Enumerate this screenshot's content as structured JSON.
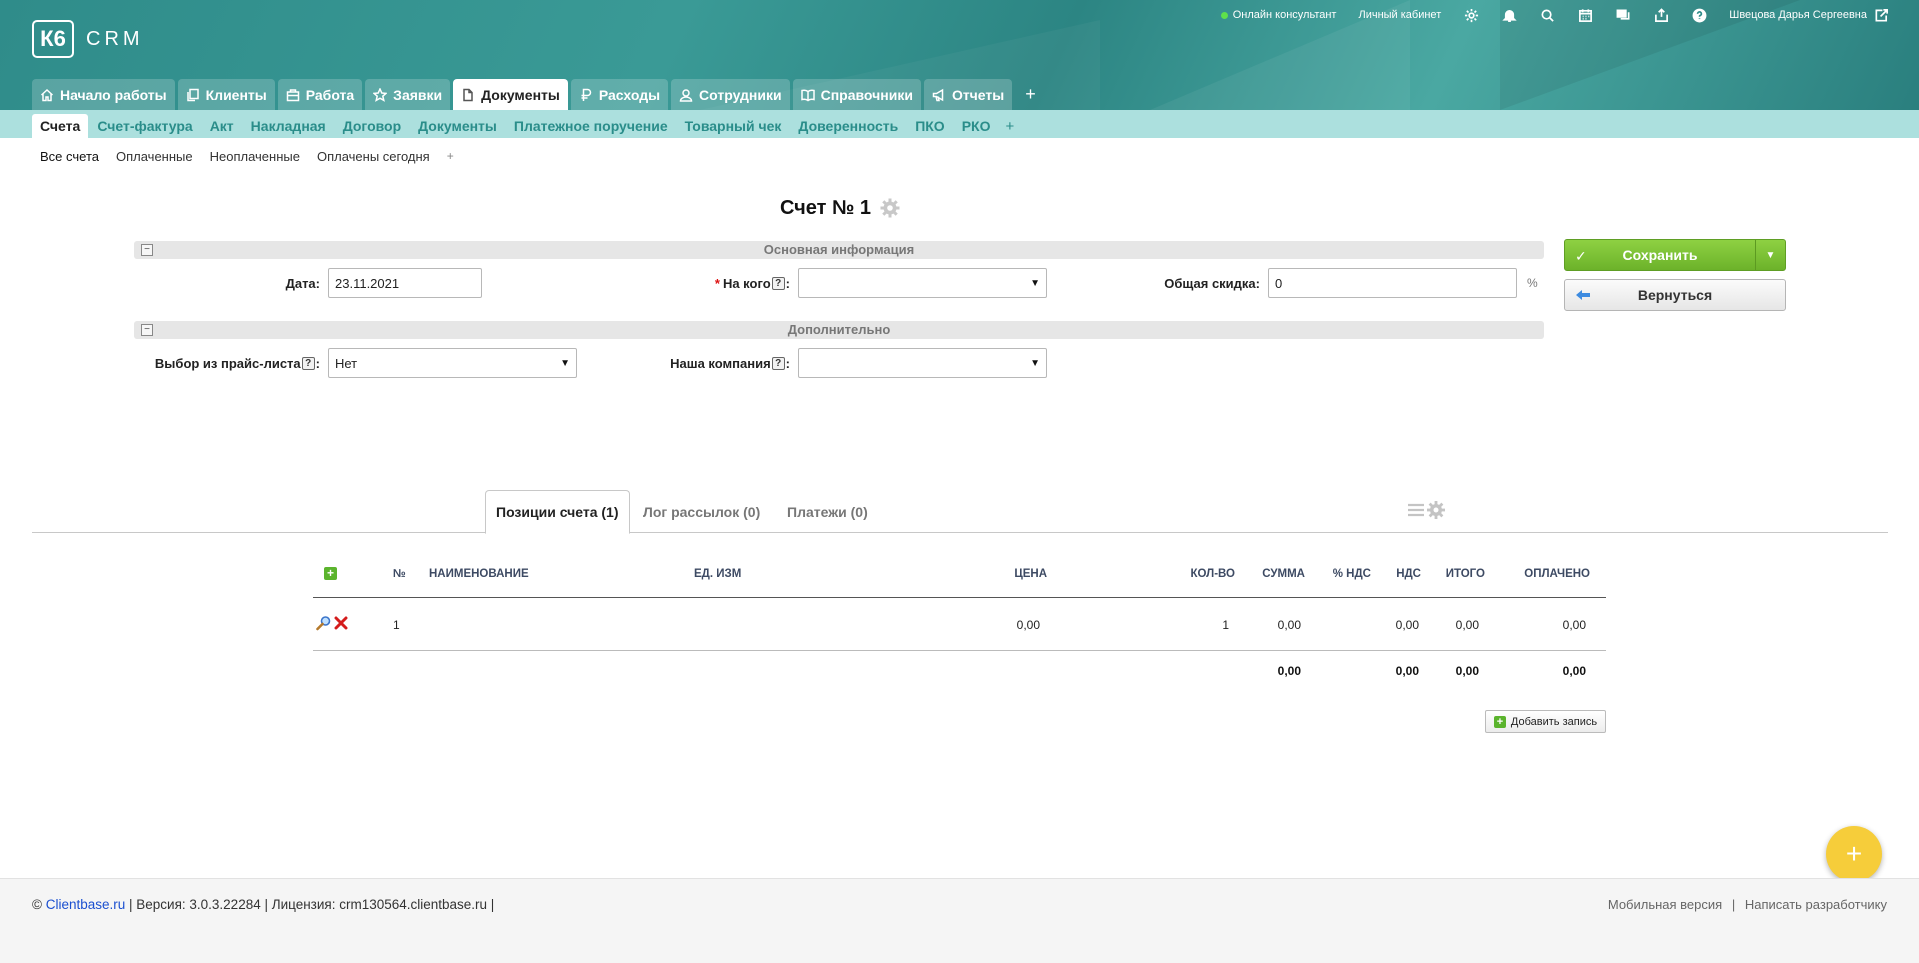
{
  "logo": {
    "mark": "К6",
    "text": "CRM"
  },
  "top_bar": {
    "online_consultant": "Онлайн консультант",
    "personal_cabinet": "Личный кабинет",
    "user_name": "Швецова Дарья Сергеевна",
    "status_color": "#5fe04a"
  },
  "main_tabs": [
    {
      "label": "Начало работы",
      "icon": "home-icon"
    },
    {
      "label": "Клиенты",
      "icon": "clients-icon"
    },
    {
      "label": "Работа",
      "icon": "work-icon"
    },
    {
      "label": "Заявки",
      "icon": "star-icon"
    },
    {
      "label": "Документы",
      "icon": "document-icon",
      "active": true
    },
    {
      "label": "Расходы",
      "icon": "ruble-icon"
    },
    {
      "label": "Сотрудники",
      "icon": "employees-icon"
    },
    {
      "label": "Справочники",
      "icon": "book-icon"
    },
    {
      "label": "Отчеты",
      "icon": "megaphone-icon"
    }
  ],
  "main_tabs_add": "+",
  "sub_tabs": [
    "Счета",
    "Счет-фактура",
    "Акт",
    "Накладная",
    "Договор",
    "Документы",
    "Платежное поручение",
    "Товарный чек",
    "Доверенность",
    "ПКО",
    "РКО"
  ],
  "sub_tabs_add": "+",
  "filters": [
    "Все счета",
    "Оплаченные",
    "Неоплаченные",
    "Оплачены сегодня"
  ],
  "filters_add": "+",
  "page_title": "Счет № 1",
  "sections": {
    "main": {
      "title": "Основная информация",
      "toggle": "−"
    },
    "extra": {
      "title": "Дополнительно",
      "toggle": "−"
    }
  },
  "form": {
    "date_label": "Дата:",
    "date_value": "23.11.2021",
    "recipient_req": "*",
    "recipient_label": "На кого",
    "recipient_value": "",
    "discount_label": "Общая скидка:",
    "discount_value": "0",
    "discount_unit": "%",
    "price_list_label": "Выбор из прайс-листа",
    "price_list_value": "Нет",
    "company_label": "Наша компания",
    "company_value": "",
    "help": "?",
    "colon": ":",
    "arrow": "▼"
  },
  "buttons": {
    "save": "Сохранить",
    "save_check": "✓",
    "save_dropdown": "▼",
    "back": "Вернуться",
    "add_record": "Добавить запись",
    "add_plus": "+",
    "fab": "+"
  },
  "lower_tabs": [
    "Позиции счета (1)",
    "Лог рассылок (0)",
    "Платежи (0)"
  ],
  "table": {
    "headers": {
      "num": "№",
      "name": "НАИМЕНОВАНИЕ",
      "unit": "ЕД. ИЗМ",
      "price": "ЦЕНА",
      "qty": "КОЛ-ВО",
      "sum": "СУММА",
      "vat_pct": "% НДС",
      "vat": "НДС",
      "total": "ИТОГО",
      "paid": "ОПЛАЧЕНО"
    },
    "rows": [
      {
        "num": "1",
        "name": "",
        "unit": "",
        "price": "0,00",
        "qty": "1",
        "sum": "0,00",
        "vat_pct": "",
        "vat": "0,00",
        "total": "0,00",
        "paid": "0,00"
      }
    ],
    "totals": {
      "sum": "0,00",
      "vat": "0,00",
      "total": "0,00",
      "paid": "0,00"
    }
  },
  "footer": {
    "copyright": "©",
    "site": "Clientbase.ru",
    "info": " | Версия: 3.0.3.22284 | Лицензия: crm130564.clientbase.ru |",
    "mobile": "Мобильная версия",
    "sep": "|",
    "write_dev": "Написать разработчику"
  },
  "colors": {
    "header": "#2f8c8a",
    "subbar": "#ace0de",
    "subtab_text": "#2a8d8a",
    "save_button": "#7cc236",
    "fab": "#f6cd3a",
    "link": "#1a4fd0"
  }
}
